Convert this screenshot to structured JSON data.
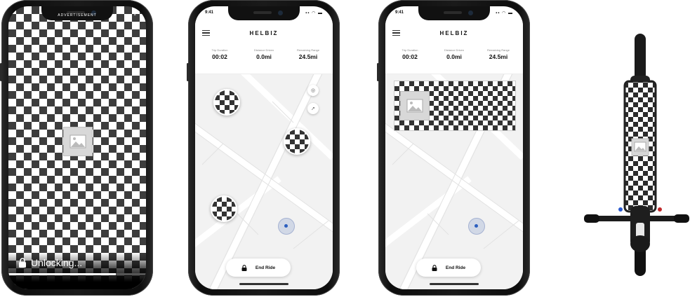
{
  "phone1": {
    "ad_label": "ADVERTISEMENT",
    "close_glyph": "×",
    "unlock_text": "Unlocking...",
    "unlock_progress": 0.78,
    "icons": [
      "lock-icon",
      "image-placeholder-icon"
    ]
  },
  "phone2": {
    "status_time": "9:41",
    "brand": "HELBIZ",
    "stats": [
      {
        "label": "Trip Duration",
        "value": "00:02"
      },
      {
        "label": "Distance Driven",
        "value": "0.0mi"
      },
      {
        "label": "Remaining Range",
        "value": "24.5mi"
      }
    ],
    "end_ride_label": "End Ride",
    "icons": [
      "menu-icon",
      "locate-icon",
      "navigate-icon",
      "lock-icon",
      "scooter-pin"
    ]
  },
  "phone3": {
    "status_time": "9:41",
    "brand": "HELBIZ",
    "stats": [
      {
        "label": "Trip Duration",
        "value": "00:02"
      },
      {
        "label": "Distance Driven",
        "value": "0.0mi"
      },
      {
        "label": "Remaining Range",
        "value": "24.5mi"
      }
    ],
    "end_ride_label": "End Ride",
    "icons": [
      "menu-icon",
      "image-placeholder-icon",
      "lock-icon"
    ]
  },
  "colors": {
    "checker_dark": "#3d3d3d",
    "locator_dot": "#2c5fbf",
    "map_background": "#f2f2f2"
  }
}
